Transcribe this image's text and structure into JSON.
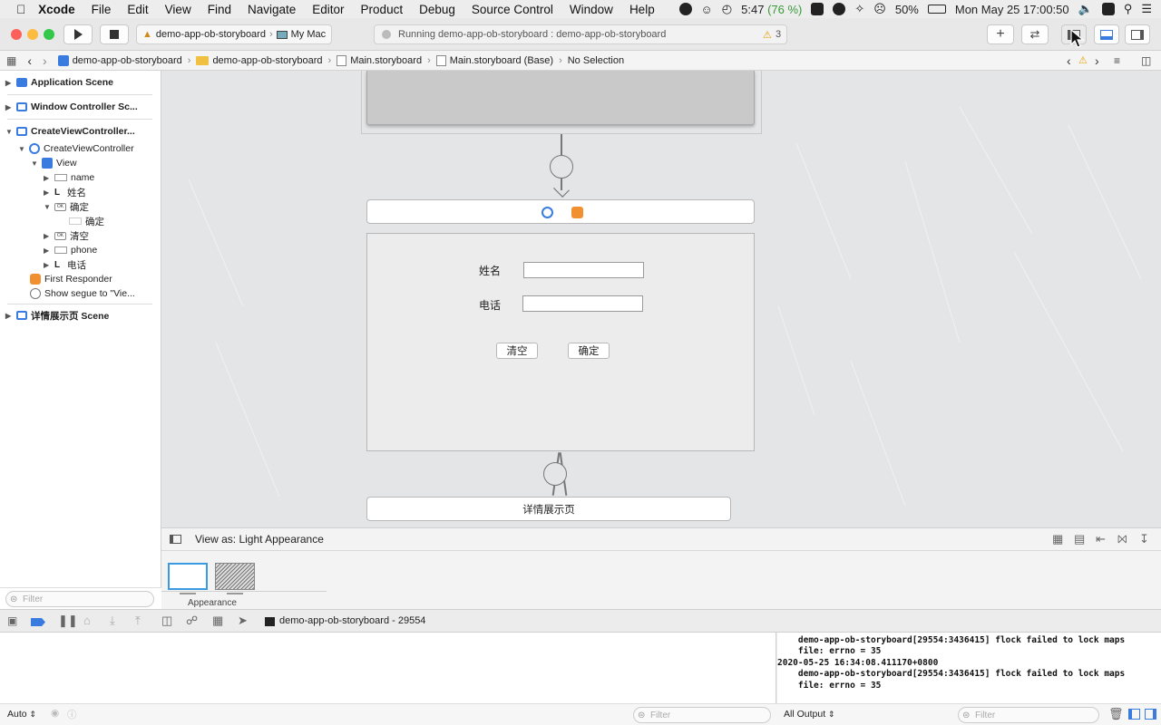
{
  "menubar": {
    "app_name": "Xcode",
    "items": [
      "File",
      "Edit",
      "View",
      "Find",
      "Navigate",
      "Editor",
      "Product",
      "Debug",
      "Source Control",
      "Window",
      "Help"
    ],
    "timer": "5:47",
    "timer_pct": "(76 %)",
    "battery": "50%",
    "datetime": "Mon May 25  17:00:50"
  },
  "toolbar": {
    "scheme_target": "demo-app-ob-storyboard",
    "scheme_device": "My Mac",
    "activity_text": "Running demo-app-ob-storyboard : demo-app-ob-storyboard",
    "warning_count": "3"
  },
  "jumpbar": {
    "crumbs": [
      "demo-app-ob-storyboard",
      "demo-app-ob-storyboard",
      "Main.storyboard",
      "Main.storyboard (Base)",
      "No Selection"
    ]
  },
  "navigator": {
    "scene_1": "Application Scene",
    "scene_2": "Window Controller Sc...",
    "scene_3": "CreateViewController...",
    "vc": "CreateViewController",
    "view": "View",
    "item_name": "name",
    "item_label_name": "姓名",
    "item_confirm": "确定",
    "item_confirm_child": "确定",
    "item_clear": "清空",
    "item_phone": "phone",
    "item_label_phone": "电话",
    "first_responder": "First Responder",
    "segue": "Show segue to \"Vie...",
    "scene_4": "详情展示页 Scene",
    "filter_placeholder": "Filter"
  },
  "canvas": {
    "label_name": "姓名",
    "label_phone": "电话",
    "btn_clear": "清空",
    "btn_confirm": "确定",
    "detail_title": "详情展示页"
  },
  "viewas": {
    "label": "View as: Light Appearance",
    "appearance_caption": "Appearance"
  },
  "debug": {
    "process": "demo-app-ob-storyboard - 29554",
    "console_lines": [
      "    demo-app-ob-storyboard[29554:3436415] flock failed to lock maps",
      "    file: errno = 35",
      "2020-05-25 16:34:08.411170+0800",
      "    demo-app-ob-storyboard[29554:3436415] flock failed to lock maps",
      "    file: errno = 35"
    ],
    "auto_label": "Auto",
    "output_label": "All Output",
    "filter_placeholder": "Filter",
    "filter_placeholder_2": "Filter"
  },
  "colors": {
    "accent": "#3a7be0",
    "traffic_red": "#fc605b",
    "traffic_yellow": "#fdbc40",
    "traffic_green": "#34c84a",
    "canvas_bg": "#e3e5e6"
  }
}
